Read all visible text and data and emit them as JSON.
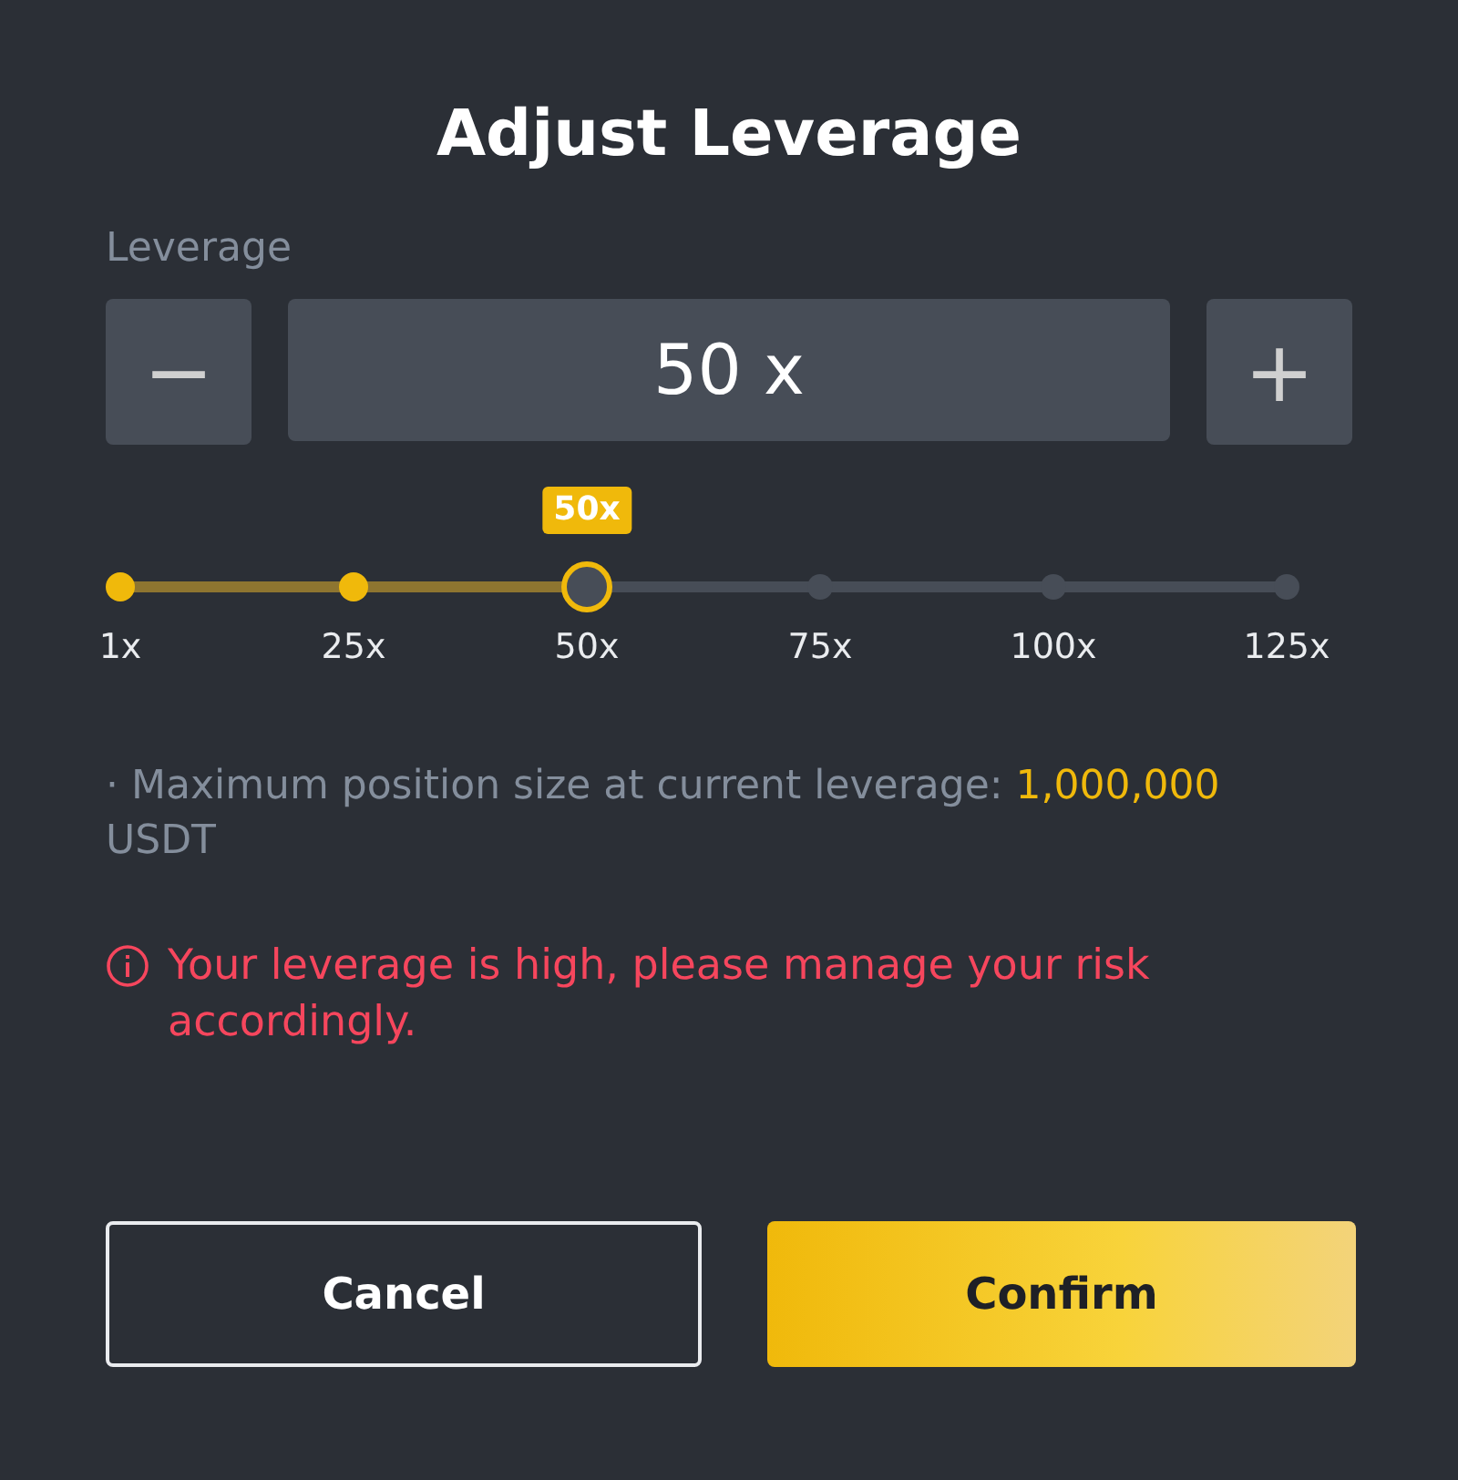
{
  "dialog": {
    "title": "Adjust Leverage"
  },
  "leverage": {
    "label": "Leverage",
    "minus": "−",
    "value": "50 x",
    "plus": "+"
  },
  "slider": {
    "level": 0.4,
    "badge": "50x",
    "ticks": [
      "1x",
      "25x",
      "50x",
      "75x",
      "100x",
      "125x"
    ]
  },
  "note": "· Maximum position size at current leverage: **1,000,000** USDT",
  "warning": "Your leverage is high, please manage your risk accordingly.",
  "buttons": [
    {
      "label": "Cancel",
      "kind": "secondary"
    },
    {
      "label": "Confirm",
      "kind": "primary"
    }
  ]
}
